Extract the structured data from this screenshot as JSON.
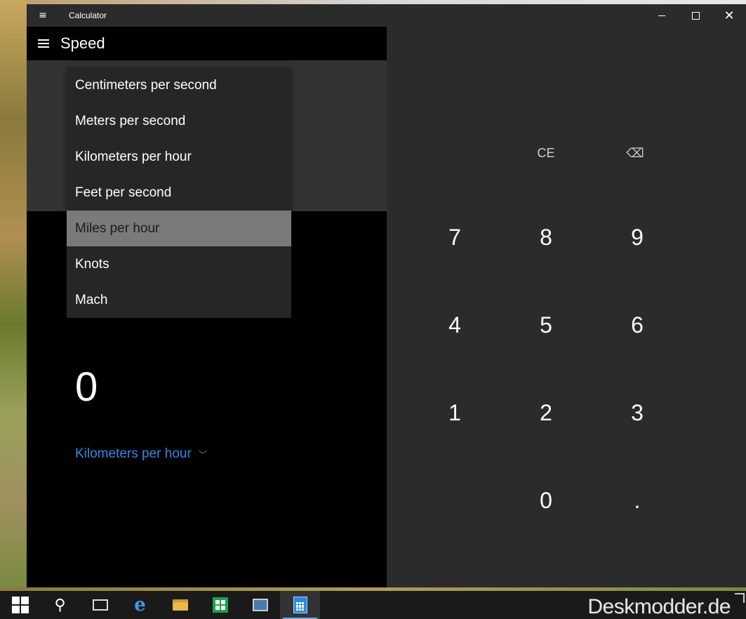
{
  "window": {
    "title": "Calculator"
  },
  "header": {
    "mode": "Speed"
  },
  "dropdown": {
    "items": [
      "Centimeters per second",
      "Meters per second",
      "Kilometers per hour",
      "Feet per second",
      "Miles per hour",
      "Knots",
      "Mach"
    ],
    "selected": "Miles per hour"
  },
  "display": {
    "value": "0",
    "unit": "Kilometers per hour"
  },
  "keypad": {
    "ce": "CE",
    "backspace": "⌫",
    "k7": "7",
    "k8": "8",
    "k9": "9",
    "k4": "4",
    "k5": "5",
    "k6": "6",
    "k1": "1",
    "k2": "2",
    "k3": "3",
    "k0": "0",
    "decimal": "."
  },
  "watermark": "Deskmodder.de",
  "colors": {
    "accent": "#2d8ae6",
    "selected_item": "#7a7a7a",
    "keypad_bg": "#2b2b2b"
  }
}
